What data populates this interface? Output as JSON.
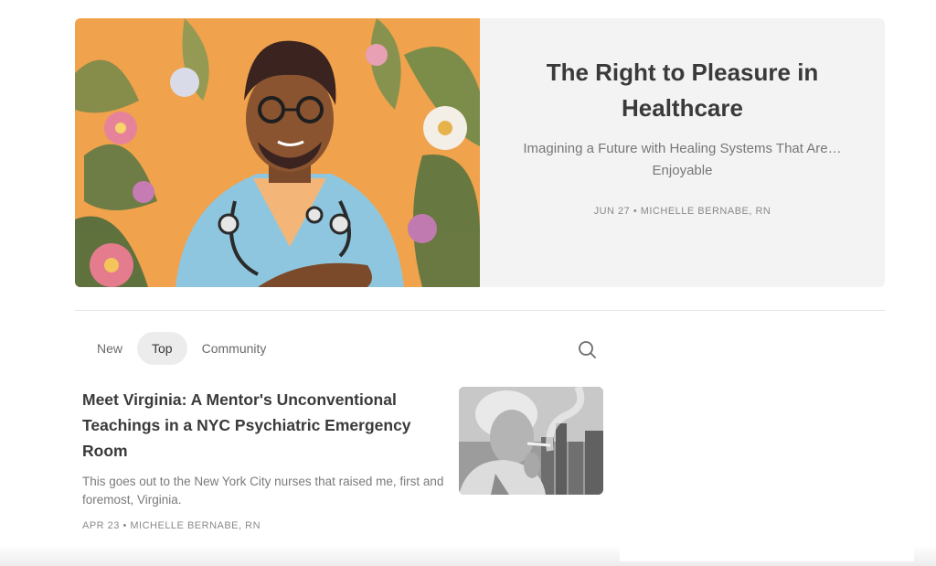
{
  "hero": {
    "image_alt": "Illustration of a smiling nurse with glasses and stethoscope among flowers",
    "title": "The Right to Pleasure in Healthcare",
    "subtitle": "Imagining a Future with Healing Systems That Are… Enjoyable",
    "meta": "JUN 27 • MICHELLE BERNABE, RN"
  },
  "tabs": [
    {
      "label": "New",
      "active": false
    },
    {
      "label": "Top",
      "active": true
    },
    {
      "label": "Community",
      "active": false
    }
  ],
  "search": {
    "icon": "search-icon"
  },
  "posts": [
    {
      "title": "Meet Virginia: A Mentor's Unconventional Teachings in a NYC Psychiatric Emergency Room",
      "excerpt": "This goes out to the New York City nurses that raised me, first and foremost, Virginia.",
      "meta": "APR 23 • MICHELLE BERNABE, RN",
      "thumb_alt": "Black and white illustration of an older woman smoking in front of a city skyline"
    }
  ],
  "colors": {
    "hero_bg": "#f3f3f3",
    "hero_image_bg": "#f0a24c",
    "active_tab_bg": "#ececec",
    "title_text": "#3a3a3a",
    "muted_text": "#8a8a8a"
  }
}
